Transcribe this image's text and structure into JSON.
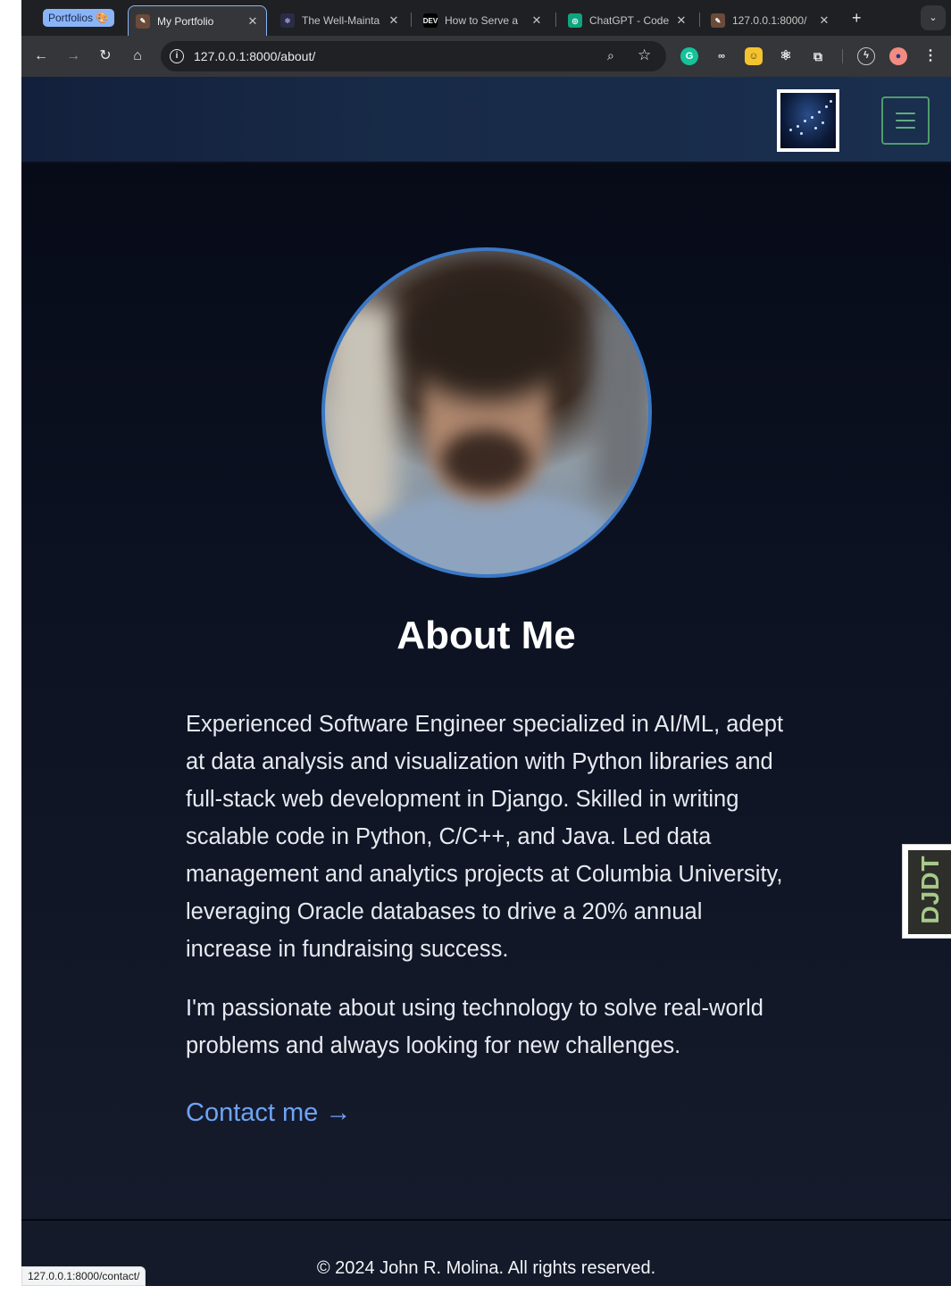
{
  "browser": {
    "tab_group_label": "Portfolios 🎨",
    "tabs": [
      {
        "title": "My Portfolio",
        "active": true,
        "favicon": "portfolio-favicon"
      },
      {
        "title": "The Well-Mainta",
        "active": false,
        "favicon": "bug-favicon"
      },
      {
        "title": "How to Serve a",
        "active": false,
        "favicon": "dev-favicon",
        "favicon_text": "DEV"
      },
      {
        "title": "ChatGPT - Code",
        "active": false,
        "favicon": "chatgpt-favicon"
      },
      {
        "title": "127.0.0.1:8000/",
        "active": false,
        "favicon": "portfolio-favicon"
      }
    ],
    "url": "127.0.0.1:8000/about/",
    "status_url": "127.0.0.1:8000/contact/"
  },
  "icons": {
    "back": "back-arrow-icon",
    "forward": "forward-arrow-icon",
    "reload": "reload-icon",
    "home": "home-icon",
    "info": "site-info-icon",
    "zoom": "zoom-icon",
    "star": "bookmark-star-icon",
    "extensions": [
      "grammarly-icon",
      "glasses-icon",
      "face-extension-icon",
      "react-devtools-icon",
      "puzzle-extensions-icon",
      "performance-icon",
      "profile-avatar-icon",
      "more-menu-icon"
    ]
  },
  "site": {
    "about_title": "About Me",
    "bio": "Experienced Software Engineer specialized in AI/ML, adept at data analysis and visualization with Python libraries and full-stack web development in Django. Skilled in writing scalable code in Python, C/C++, and Java. Led data management and analytics projects at Columbia University, leveraging Oracle databases to drive a 20% annual increase in fundraising success.",
    "bio2": "I'm passionate about using technology to solve real-world problems and always looking for new challenges.",
    "contact_link": "Contact me →",
    "footer": "© 2024 John R. Molina. All rights reserved.",
    "djdt_label": "DJDT"
  },
  "colors": {
    "accent_link": "#6ea4f5",
    "avatar_border": "#3b78c5",
    "menu_border": "#4f9c6b"
  }
}
